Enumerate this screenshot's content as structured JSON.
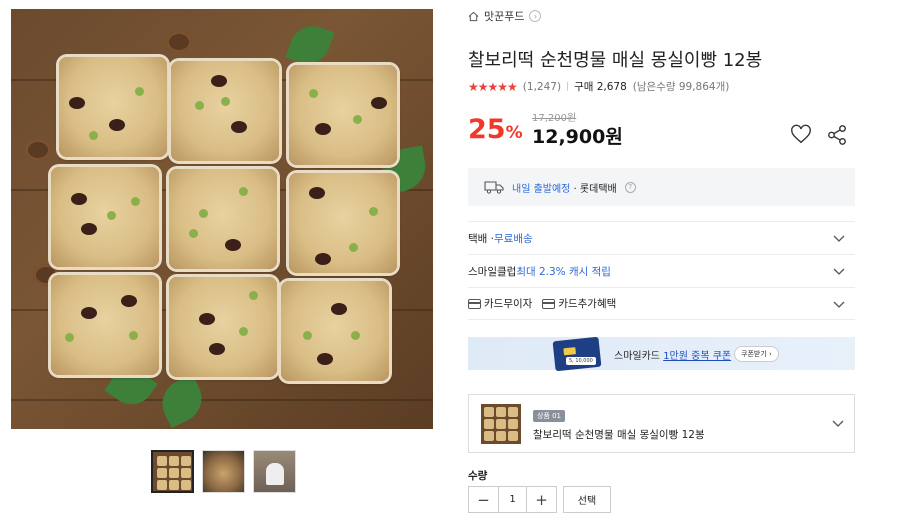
{
  "store": {
    "name": "맛꾼푸드"
  },
  "product": {
    "title": "찰보리떡 순천명물 매실 몽실이빵 12봉",
    "stars": "★★★★★",
    "review_count": "(1,247)",
    "purchase_label": "구매 2,678",
    "stock_text": "(남은수량 99,864개)",
    "original_price": "17,200원",
    "discount_number": "25",
    "discount_unit": "%",
    "sale_price": "12,900원"
  },
  "delivery": {
    "highlight": "내일 출발예정",
    "carrier": "· 롯데택배"
  },
  "options": {
    "shipping_label": "택배 · ",
    "shipping_value": "무료배송",
    "smileclub_label": "스마일클럽 ",
    "smileclub_value": "최대 2.3% 캐시 적립",
    "card_interest": "카드무이자",
    "card_benefit": "카드추가혜택"
  },
  "banner": {
    "card_points": "5, 10,000",
    "text_prefix": "스마일카드 ",
    "text_highlight": "1만원 중복 쿠폰",
    "button": "쿠폰받기 ›"
  },
  "selected_item": {
    "badge": "상품 01",
    "name": "찰보리떡 순천명물 매실 몽실이빵 12봉"
  },
  "quantity": {
    "label": "수량",
    "minus": "−",
    "value": "1",
    "plus": "+",
    "select_button": "선택"
  },
  "colors": {
    "accent_red": "#f0392b",
    "link_blue": "#2c6bd6"
  },
  "icons": [
    "home-icon",
    "circle-arrow-icon",
    "heart-icon",
    "share-icon",
    "truck-icon",
    "question-icon",
    "chevron-down-icon",
    "card-icon"
  ]
}
